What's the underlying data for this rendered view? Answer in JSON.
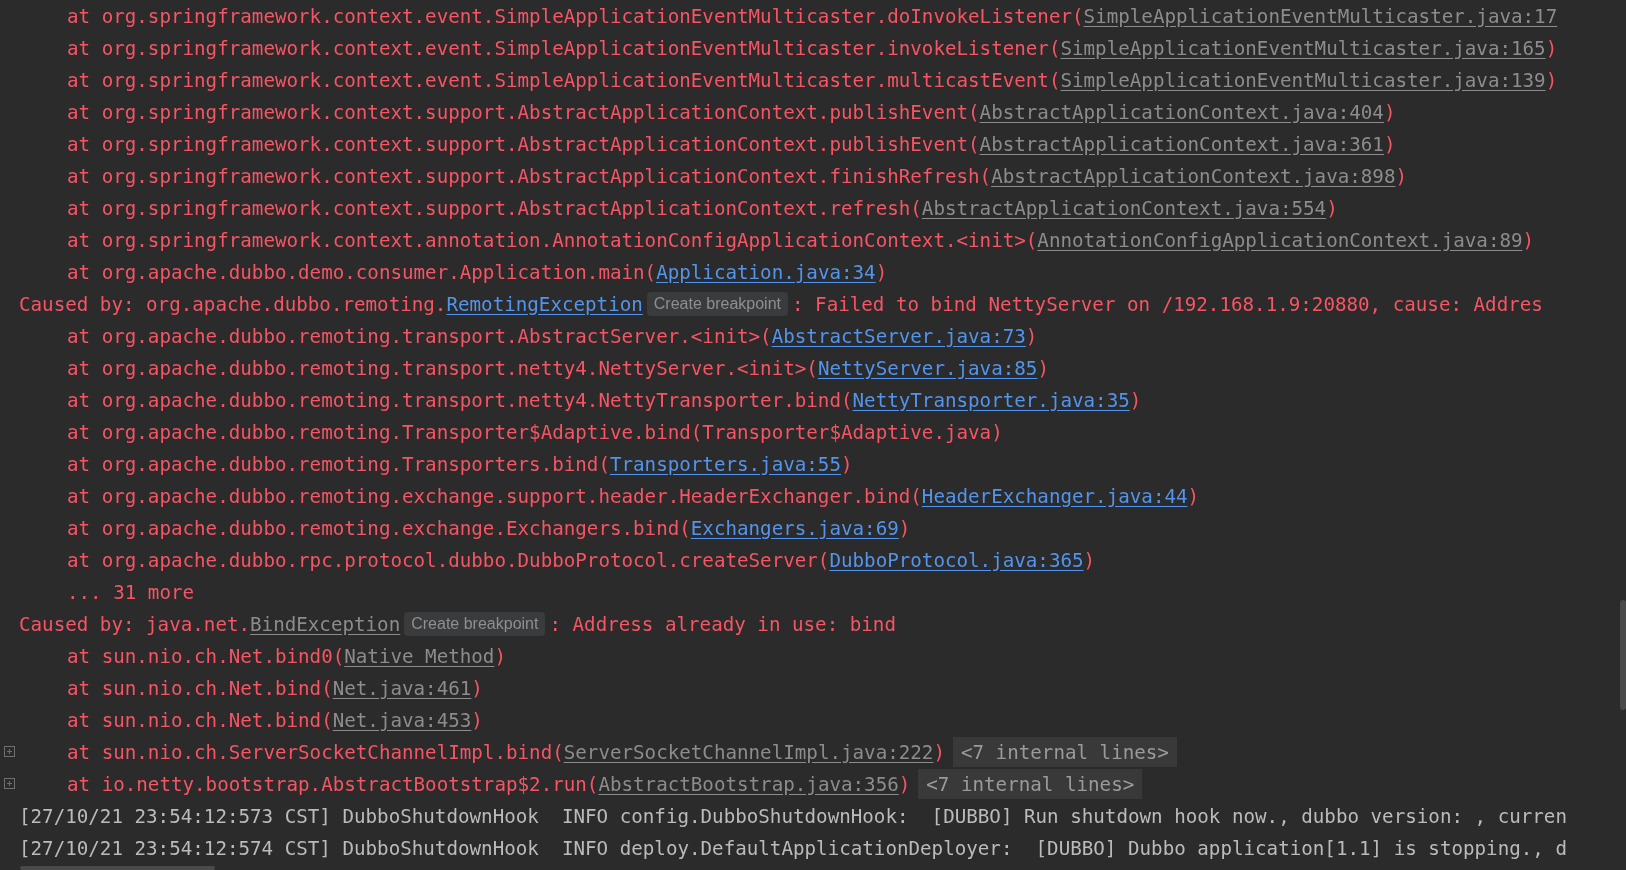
{
  "console": {
    "lines": [
      {
        "kind": "frame",
        "foldable": false,
        "segments": [
          {
            "kind": "text",
            "text": "at org.springframework.context.event.SimpleApplicationEventMulticaster.doInvokeListener("
          },
          {
            "kind": "library_link",
            "text": "SimpleApplicationEventMulticaster.java:17"
          }
        ]
      },
      {
        "kind": "frame",
        "foldable": false,
        "segments": [
          {
            "kind": "text",
            "text": "at org.springframework.context.event.SimpleApplicationEventMulticaster.invokeListener("
          },
          {
            "kind": "library_link",
            "text": "SimpleApplicationEventMulticaster.java:165"
          },
          {
            "kind": "text",
            "text": ")"
          }
        ]
      },
      {
        "kind": "frame",
        "foldable": false,
        "segments": [
          {
            "kind": "text",
            "text": "at org.springframework.context.event.SimpleApplicationEventMulticaster.multicastEvent("
          },
          {
            "kind": "library_link",
            "text": "SimpleApplicationEventMulticaster.java:139"
          },
          {
            "kind": "text",
            "text": ")"
          }
        ]
      },
      {
        "kind": "frame",
        "foldable": false,
        "segments": [
          {
            "kind": "text",
            "text": "at org.springframework.context.support.AbstractApplicationContext.publishEvent("
          },
          {
            "kind": "library_link",
            "text": "AbstractApplicationContext.java:404"
          },
          {
            "kind": "text",
            "text": ")"
          }
        ]
      },
      {
        "kind": "frame",
        "foldable": false,
        "segments": [
          {
            "kind": "text",
            "text": "at org.springframework.context.support.AbstractApplicationContext.publishEvent("
          },
          {
            "kind": "library_link",
            "text": "AbstractApplicationContext.java:361"
          },
          {
            "kind": "text",
            "text": ")"
          }
        ]
      },
      {
        "kind": "frame",
        "foldable": false,
        "segments": [
          {
            "kind": "text",
            "text": "at org.springframework.context.support.AbstractApplicationContext.finishRefresh("
          },
          {
            "kind": "library_link",
            "text": "AbstractApplicationContext.java:898"
          },
          {
            "kind": "text",
            "text": ")"
          }
        ]
      },
      {
        "kind": "frame",
        "foldable": false,
        "segments": [
          {
            "kind": "text",
            "text": "at org.springframework.context.support.AbstractApplicationContext.refresh("
          },
          {
            "kind": "library_link",
            "text": "AbstractApplicationContext.java:554"
          },
          {
            "kind": "text",
            "text": ")"
          }
        ]
      },
      {
        "kind": "frame",
        "foldable": false,
        "segments": [
          {
            "kind": "text",
            "text": "at org.springframework.context.annotation.AnnotationConfigApplicationContext.<init>("
          },
          {
            "kind": "library_link",
            "text": "AnnotationConfigApplicationContext.java:89"
          },
          {
            "kind": "text",
            "text": ")"
          }
        ]
      },
      {
        "kind": "frame",
        "foldable": false,
        "segments": [
          {
            "kind": "text",
            "text": "at org.apache.dubbo.demo.consumer.Application.main("
          },
          {
            "kind": "project_link",
            "text": "Application.java:34"
          },
          {
            "kind": "text",
            "text": ")"
          }
        ]
      },
      {
        "kind": "cause",
        "foldable": false,
        "segments": [
          {
            "kind": "text",
            "text": "Caused by: org.apache.dubbo.remoting."
          },
          {
            "kind": "project_link",
            "text": "RemotingException"
          },
          {
            "kind": "hint",
            "text": "Create breakpoint"
          },
          {
            "kind": "text",
            "text": ": Failed to bind NettyServer on /192.168.1.9:20880, cause: Addres"
          }
        ]
      },
      {
        "kind": "frame",
        "foldable": false,
        "segments": [
          {
            "kind": "text",
            "text": "at org.apache.dubbo.remoting.transport.AbstractServer.<init>("
          },
          {
            "kind": "project_link",
            "text": "AbstractServer.java:73"
          },
          {
            "kind": "text",
            "text": ")"
          }
        ]
      },
      {
        "kind": "frame",
        "foldable": false,
        "segments": [
          {
            "kind": "text",
            "text": "at org.apache.dubbo.remoting.transport.netty4.NettyServer.<init>("
          },
          {
            "kind": "project_link",
            "text": "NettyServer.java:85"
          },
          {
            "kind": "text",
            "text": ")"
          }
        ]
      },
      {
        "kind": "frame",
        "foldable": false,
        "segments": [
          {
            "kind": "text",
            "text": "at org.apache.dubbo.remoting.transport.netty4.NettyTransporter.bind("
          },
          {
            "kind": "project_link",
            "text": "NettyTransporter.java:35"
          },
          {
            "kind": "text",
            "text": ")"
          }
        ]
      },
      {
        "kind": "frame",
        "foldable": false,
        "segments": [
          {
            "kind": "text",
            "text": "at org.apache.dubbo.remoting.Transporter$Adaptive.bind(Transporter$Adaptive.java)"
          }
        ]
      },
      {
        "kind": "frame",
        "foldable": false,
        "segments": [
          {
            "kind": "text",
            "text": "at org.apache.dubbo.remoting.Transporters.bind("
          },
          {
            "kind": "project_link",
            "text": "Transporters.java:55"
          },
          {
            "kind": "text",
            "text": ")"
          }
        ]
      },
      {
        "kind": "frame",
        "foldable": false,
        "segments": [
          {
            "kind": "text",
            "text": "at org.apache.dubbo.remoting.exchange.support.header.HeaderExchanger.bind("
          },
          {
            "kind": "project_link",
            "text": "HeaderExchanger.java:44"
          },
          {
            "kind": "text",
            "text": ")"
          }
        ]
      },
      {
        "kind": "frame",
        "foldable": false,
        "segments": [
          {
            "kind": "text",
            "text": "at org.apache.dubbo.remoting.exchange.Exchangers.bind("
          },
          {
            "kind": "project_link",
            "text": "Exchangers.java:69"
          },
          {
            "kind": "text",
            "text": ")"
          }
        ]
      },
      {
        "kind": "frame",
        "foldable": false,
        "segments": [
          {
            "kind": "text",
            "text": "at org.apache.dubbo.rpc.protocol.dubbo.DubboProtocol.createServer("
          },
          {
            "kind": "project_link",
            "text": "DubboProtocol.java:365"
          },
          {
            "kind": "text",
            "text": ")"
          }
        ]
      },
      {
        "kind": "frame",
        "foldable": false,
        "segments": [
          {
            "kind": "text",
            "text": "... 31 more"
          }
        ]
      },
      {
        "kind": "cause",
        "foldable": false,
        "segments": [
          {
            "kind": "text",
            "text": "Caused by: java.net."
          },
          {
            "kind": "library_link",
            "text": "BindException"
          },
          {
            "kind": "hint",
            "text": "Create breakpoint"
          },
          {
            "kind": "text",
            "text": ": Address already in use: bind"
          }
        ]
      },
      {
        "kind": "frame",
        "foldable": false,
        "segments": [
          {
            "kind": "text",
            "text": "at sun.nio.ch.Net.bind0("
          },
          {
            "kind": "library_link",
            "text": "Native Method"
          },
          {
            "kind": "text",
            "text": ")"
          }
        ]
      },
      {
        "kind": "frame",
        "foldable": false,
        "segments": [
          {
            "kind": "text",
            "text": "at sun.nio.ch.Net.bind("
          },
          {
            "kind": "library_link",
            "text": "Net.java:461"
          },
          {
            "kind": "text",
            "text": ")"
          }
        ]
      },
      {
        "kind": "frame",
        "foldable": false,
        "segments": [
          {
            "kind": "text",
            "text": "at sun.nio.ch.Net.bind("
          },
          {
            "kind": "library_link",
            "text": "Net.java:453"
          },
          {
            "kind": "text",
            "text": ")"
          }
        ]
      },
      {
        "kind": "frame",
        "foldable": true,
        "segments": [
          {
            "kind": "text",
            "text": "at sun.nio.ch.ServerSocketChannelImpl.bind("
          },
          {
            "kind": "library_link",
            "text": "ServerSocketChannelImpl.java:222"
          },
          {
            "kind": "text",
            "text": ")"
          },
          {
            "kind": "fold",
            "text": "<7 internal lines>"
          }
        ]
      },
      {
        "kind": "frame",
        "foldable": true,
        "segments": [
          {
            "kind": "text",
            "text": "at io.netty.bootstrap.AbstractBootstrap$2.run("
          },
          {
            "kind": "library_link",
            "text": "AbstractBootstrap.java:356"
          },
          {
            "kind": "text",
            "text": ")"
          },
          {
            "kind": "fold",
            "text": "<7 internal lines>"
          }
        ]
      },
      {
        "kind": "log",
        "foldable": false,
        "segments": [
          {
            "kind": "text",
            "text": "[27/10/21 23:54:12:573 CST] DubboShutdownHook  INFO config.DubboShutdownHook:  [DUBBO] Run shutdown hook now., dubbo version: , curren"
          }
        ]
      },
      {
        "kind": "log",
        "foldable": false,
        "segments": [
          {
            "kind": "text",
            "text": "[27/10/21 23:54:12:574 CST] DubboShutdownHook  INFO deploy.DefaultApplicationDeployer:  [DUBBO] Dubbo application[1.1] is stopping., d"
          }
        ]
      }
    ]
  }
}
